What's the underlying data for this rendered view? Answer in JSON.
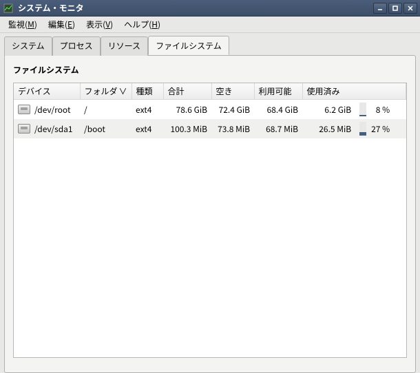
{
  "window": {
    "title": "システム・モニタ"
  },
  "menubar": {
    "monitor": {
      "label": "監視",
      "key": "M"
    },
    "edit": {
      "label": "編集",
      "key": "E"
    },
    "view": {
      "label": "表示",
      "key": "V"
    },
    "help": {
      "label": "ヘルプ",
      "key": "H"
    }
  },
  "tabs": {
    "system": "システム",
    "processes": "プロセス",
    "resources": "リソース",
    "filesystems": "ファイルシステム"
  },
  "section": {
    "title": "ファイルシステム"
  },
  "columns": {
    "device": "デバイス",
    "folder": "フォルダ",
    "type": "種類",
    "total": "合計",
    "free": "空き",
    "available": "利用可能",
    "used": "使用済み"
  },
  "sort_indicator": "∨",
  "rows": [
    {
      "device": "/dev/root",
      "folder": "/",
      "type": "ext4",
      "total": "78.6 GiB",
      "free": "72.4 GiB",
      "available": "68.4 GiB",
      "used": "6.2 GiB",
      "used_pct_label": "8 %",
      "used_pct": 8
    },
    {
      "device": "/dev/sda1",
      "folder": "/boot",
      "type": "ext4",
      "total": "100.3 MiB",
      "free": "73.8 MiB",
      "available": "68.7 MiB",
      "used": "26.5 MiB",
      "used_pct_label": "27 %",
      "used_pct": 27
    }
  ]
}
